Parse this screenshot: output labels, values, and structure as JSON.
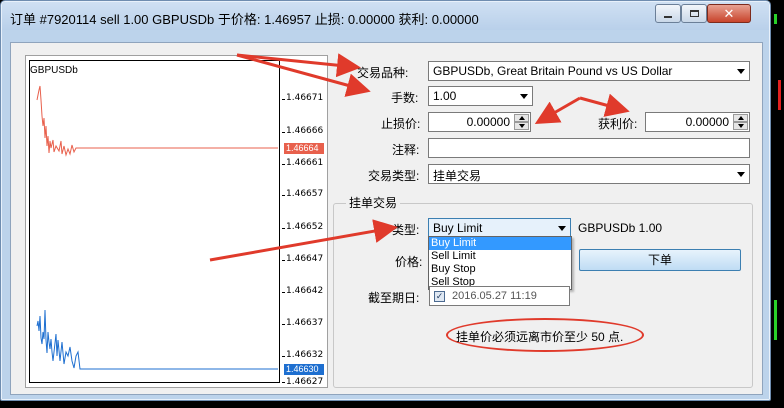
{
  "window": {
    "title": "订单 #7920114 sell 1.00 GBPUSDb 于价格: 1.46957 止损: 0.00000 获利: 0.00000",
    "close_glyph": "✕"
  },
  "chart": {
    "symbol": "GBPUSDb",
    "price_ticks": [
      "1.46671",
      "1.46666",
      "1.46661",
      "1.46657",
      "1.46652",
      "1.46647",
      "1.46642",
      "1.46637",
      "1.46632",
      "1.46627"
    ],
    "ask_flag": "1.46664",
    "bid_flag": "1.46630",
    "ask_color": "#e8604c",
    "bid_color": "#1e6fd0"
  },
  "form": {
    "symbol_label": "交易品种:",
    "symbol_value": "GBPUSDb, Great Britain Pound vs US Dollar",
    "volume_label": "手数:",
    "volume_value": "1.00",
    "stoploss_label": "止损价:",
    "stoploss_value": "0.00000",
    "takeprofit_label": "获利价:",
    "takeprofit_value": "0.00000",
    "comment_label": "注释:",
    "comment_value": "",
    "ordertype_label": "交易类型:",
    "ordertype_value": "挂单交易"
  },
  "pending": {
    "group_title": "挂单交易",
    "type_label": "类型:",
    "type_value": "Buy Limit",
    "type_options": [
      "Buy Limit",
      "Sell Limit",
      "Buy Stop",
      "Sell Stop"
    ],
    "symbol_volume": "GBPUSDb 1.00",
    "price_label": "价格:",
    "place_button": "下单",
    "expiry_label": "截至期日:",
    "expiry_value": "2016.05.27 11:19",
    "note": "挂单价必须远离市价至少 50 点."
  },
  "colors": {
    "annotation": "#e03a2b"
  }
}
